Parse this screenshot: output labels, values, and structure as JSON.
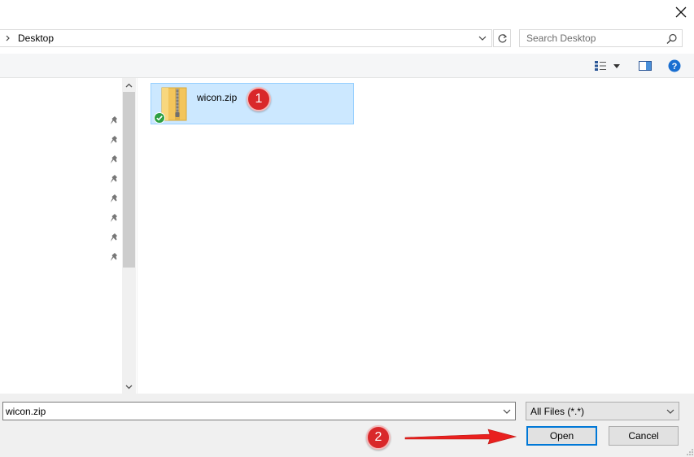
{
  "address": {
    "path": "Desktop"
  },
  "search": {
    "placeholder": "Search Desktop"
  },
  "files": [
    {
      "name": "wicon.zip",
      "type": "zip-folder",
      "sync_status": "ok"
    }
  ],
  "filename_field": {
    "value": "wicon.zip"
  },
  "file_type_filter": {
    "selected": "All Files (*.*)"
  },
  "buttons": {
    "open": "Open",
    "cancel": "Cancel"
  },
  "annotations": {
    "step1": "1",
    "step2": "2"
  },
  "icons": {
    "close": "close-icon",
    "refresh": "refresh-icon",
    "search": "search-icon",
    "view": "view-details-icon",
    "preview": "preview-pane-icon",
    "help": "help-icon",
    "pin": "pin-icon",
    "zip": "zip-folder-icon"
  },
  "colors": {
    "selection": "#cce8ff",
    "selection_border": "#99d1ff",
    "accent": "#0078d7",
    "badge": "#d9282a",
    "arrow": "#e8201f"
  }
}
